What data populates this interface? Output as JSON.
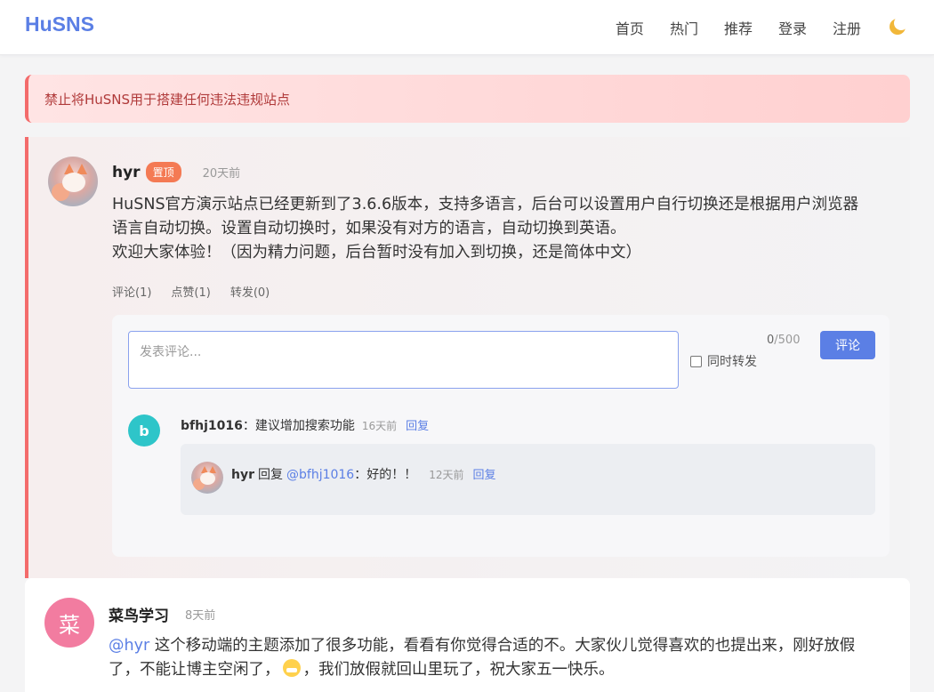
{
  "header": {
    "logo": "HuSNS",
    "nav": [
      "首页",
      "热门",
      "推荐",
      "登录",
      "注册"
    ]
  },
  "notice": "禁止将HuSNS用于搭建任何违法违规站点",
  "pinned_post": {
    "author": "hyr",
    "badge": "置顶",
    "time": "20天前",
    "lines": [
      "HuSNS官方演示站点已经更新到了3.6.6版本，支持多语言，后台可以设置用户自行切换还是根据用户浏览器",
      "语言自动切换。设置自动切换时，如果没有对方的语言，自动切换到英语。",
      "欢迎大家体验！（因为精力问题，后台暂时没有加入到切换，还是简体中文）"
    ],
    "actions": {
      "comment": "评论(1)",
      "like": "点赞(1)",
      "share": "转发(0)"
    },
    "comment_form": {
      "placeholder": "发表评论...",
      "count": "0",
      "max": "/500",
      "repost_label": "同时转发",
      "submit": "评论"
    },
    "comments": [
      {
        "avatar_letter": "b",
        "user": "bfhj1016",
        "sep": "：",
        "text": "建议增加搜索功能",
        "time": "16天前",
        "reply": "回复"
      }
    ],
    "nested_reply": {
      "user": "hyr",
      "reply_word": "回复",
      "mention": "@bfhj1016",
      "sep": "：",
      "text": "好的！！",
      "time": "12天前",
      "reply": "回复"
    }
  },
  "post2": {
    "avatar_letter": "菜",
    "author": "菜鸟学习",
    "time": "8天前",
    "mention": "@hyr",
    "line1": " 这个移动端的主题添加了很多功能，看看有你觉得合适的不。大家伙儿觉得喜欢的也提出来，刚好放假",
    "line2a": "了，不能让博主空闲了，",
    "line2b": "，我们放假就回山里玩了，祝大家五一快乐。"
  },
  "colors": {
    "brand": "#5b7fe5",
    "pin_accent": "#f36b6b",
    "badge": "#f47a54",
    "avatar_b": "#2ec5c9",
    "avatar_cai": "#f27ca0"
  }
}
